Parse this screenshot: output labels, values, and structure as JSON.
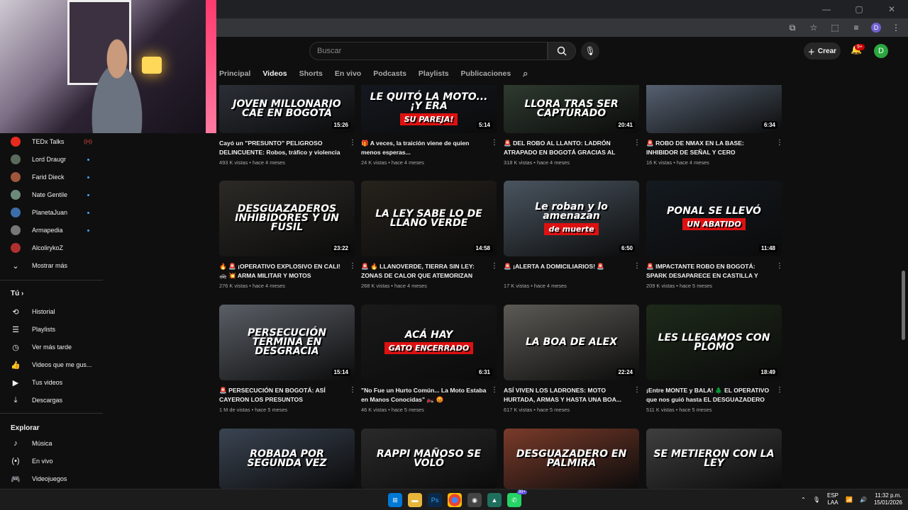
{
  "youtube": {
    "search_placeholder": "Buscar",
    "create_label": "Crear",
    "notif_badge": "9+",
    "avatar_letter": "D"
  },
  "profile_letter": "D",
  "tabs": [
    "Principal",
    "Videos",
    "Shorts",
    "En vivo",
    "Podcasts",
    "Playlists",
    "Publicaciones"
  ],
  "sidebar": {
    "subscriptions": [
      {
        "name": "TEDx Talks",
        "status": "live"
      },
      {
        "name": "Lord Draugr",
        "status": "new"
      },
      {
        "name": "Farid Dieck",
        "status": "new"
      },
      {
        "name": "Nate Gentile",
        "status": "new"
      },
      {
        "name": "PlanetaJuan",
        "status": "new"
      },
      {
        "name": "Armapedia",
        "status": "new"
      },
      {
        "name": "AlcolirykoZ",
        "status": "none"
      }
    ],
    "show_more": "Mostrar más",
    "you_header": "Tú",
    "you_items": [
      "Historial",
      "Playlists",
      "Ver más tarde",
      "Videos que me gus...",
      "Tus videos",
      "Descargas"
    ],
    "explore_header": "Explorar",
    "explore_items": [
      "Música",
      "En vivo",
      "Videojuegos"
    ]
  },
  "videos": [
    {
      "thumb_text": "JOVEN MILLONARIO CAE EN BOGOTÁ",
      "thumb_accent": "",
      "duration": "15:26",
      "title": "Cayó un \"PRESUNTO\" PELIGROSO DELINCUENTE: Robos, tráfico y violencia e...",
      "meta": "493 K vistas • hace 4 meses"
    },
    {
      "thumb_text": "LE QUITÓ LA MOTO... ¡Y ERA",
      "thumb_accent": "SU PAREJA!",
      "duration": "5:14",
      "title": "🎁 A veces, la traición viene de quien menos esperas...",
      "meta": "24 K vistas • hace 4 meses"
    },
    {
      "thumb_text": "LLORA TRAS SER CAPTURADO",
      "thumb_accent": "",
      "duration": "20:41",
      "title": "🚨 DEL ROBO AL LLANTO: LADRÓN ATRAPADO EN BOGOTÁ GRACIAS AL GPS...",
      "meta": "318 K vistas • hace 4 meses"
    },
    {
      "thumb_text": "",
      "thumb_accent": "",
      "duration": "6:34",
      "title": "🚨 ROBO DE NMAX EN LA BASE: INHIBIDOR DE SEÑAL Y CERO AUTORIDAD 🚓 ❌",
      "meta": "16 K vistas • hace 4 meses"
    },
    {
      "thumb_text": "DESGUAZADEROS INHIBIDORES Y UN FUSIL",
      "thumb_accent": "",
      "duration": "23:22",
      "title": "🔥 🚨 ¡OPERATIVO EXPLOSIVO EN CALI! 🚓 💥 ARMA MILITAR Y MOTOS ROBADAS...",
      "meta": "276 K vistas • hace 4 meses"
    },
    {
      "thumb_text": "LA LEY SABE LO DE LLANO VERDE",
      "thumb_accent": "",
      "duration": "14:58",
      "title": "🚨 🔥 LLANOVERDE, TIERRA SIN LEY: ZONAS DE CALOR QUE ATEMORIZAN CALI...",
      "meta": "268 K vistas • hace 4 meses"
    },
    {
      "thumb_text": "Le roban y lo amenazan",
      "thumb_accent": "de muerte",
      "duration": "6:50",
      "title": "🚨 ¡ALERTA A DOMICILIARIOS! 🚨",
      "meta": "17 K vistas • hace 4 meses"
    },
    {
      "thumb_text": "PONAL SE LLEVÓ",
      "thumb_accent": "UN ABATIDO",
      "duration": "11:48",
      "title": "🚨 IMPACTANTE ROBO EN BOGOTÁ: SPARK DESAPARECE EN CASTILLA Y APARECE E...",
      "meta": "209 K vistas • hace 5 meses"
    },
    {
      "thumb_text": "PERSECUCIÓN TERMINA EN DESGRACIA",
      "thumb_accent": "",
      "duration": "15:14",
      "title": "🚨 PERSECUCIÓN EN BOGOTÁ: ASÍ CAYERON LOS PRESUNTOS DELINCUENTE...",
      "meta": "1 M de vistas • hace 5 meses"
    },
    {
      "thumb_text": "ACÁ HAY",
      "thumb_accent": "GATO ENCERRADO",
      "duration": "6:31",
      "title": "\"No Fue un Hurto Común... La Moto Estaba en Manos Conocidas\" 🏍️ 😡",
      "meta": "46 K vistas • hace 5 meses"
    },
    {
      "thumb_text": "LA BOA DE ALEX",
      "thumb_accent": "",
      "duration": "22:24",
      "title": "ASÍ VIVEN LOS LADRONES: MOTO HURTADA, ARMAS Y HASTA UNA BOA...",
      "meta": "617 K vistas • hace 5 meses"
    },
    {
      "thumb_text": "LES LLEGAMOS CON PLOMO",
      "thumb_accent": "",
      "duration": "18:49",
      "title": "¡Entre MONTE y BALA! 🌲 EL OPERATIVO que nos guió hasta EL DESGUAZADERO",
      "meta": "511 K vistas • hace 5 meses"
    },
    {
      "thumb_text": "ROBADA POR SEGUNDA VEZ",
      "thumb_accent": "",
      "duration": "",
      "title": "",
      "meta": ""
    },
    {
      "thumb_text": "RAPPI MAÑOSO SE VOLÓ",
      "thumb_accent": "",
      "duration": "",
      "title": "",
      "meta": ""
    },
    {
      "thumb_text": "DESGUAZADERO EN PALMIRA",
      "thumb_accent": "",
      "duration": "",
      "title": "",
      "meta": ""
    },
    {
      "thumb_text": "SE METIERON CON LA LEY",
      "thumb_accent": "",
      "duration": "",
      "title": "",
      "meta": ""
    }
  ],
  "taskbar": {
    "language": "ESP",
    "language_sub": "LAA",
    "time": "11:32 p.m.",
    "date": "15/01/2026",
    "whatsapp_badge": "99+"
  },
  "colors": {
    "background": "#0f0f0f",
    "accent_red": "#ff0000",
    "avatar_green": "#2ba640",
    "live_dot_blue": "#3ea6ff"
  }
}
